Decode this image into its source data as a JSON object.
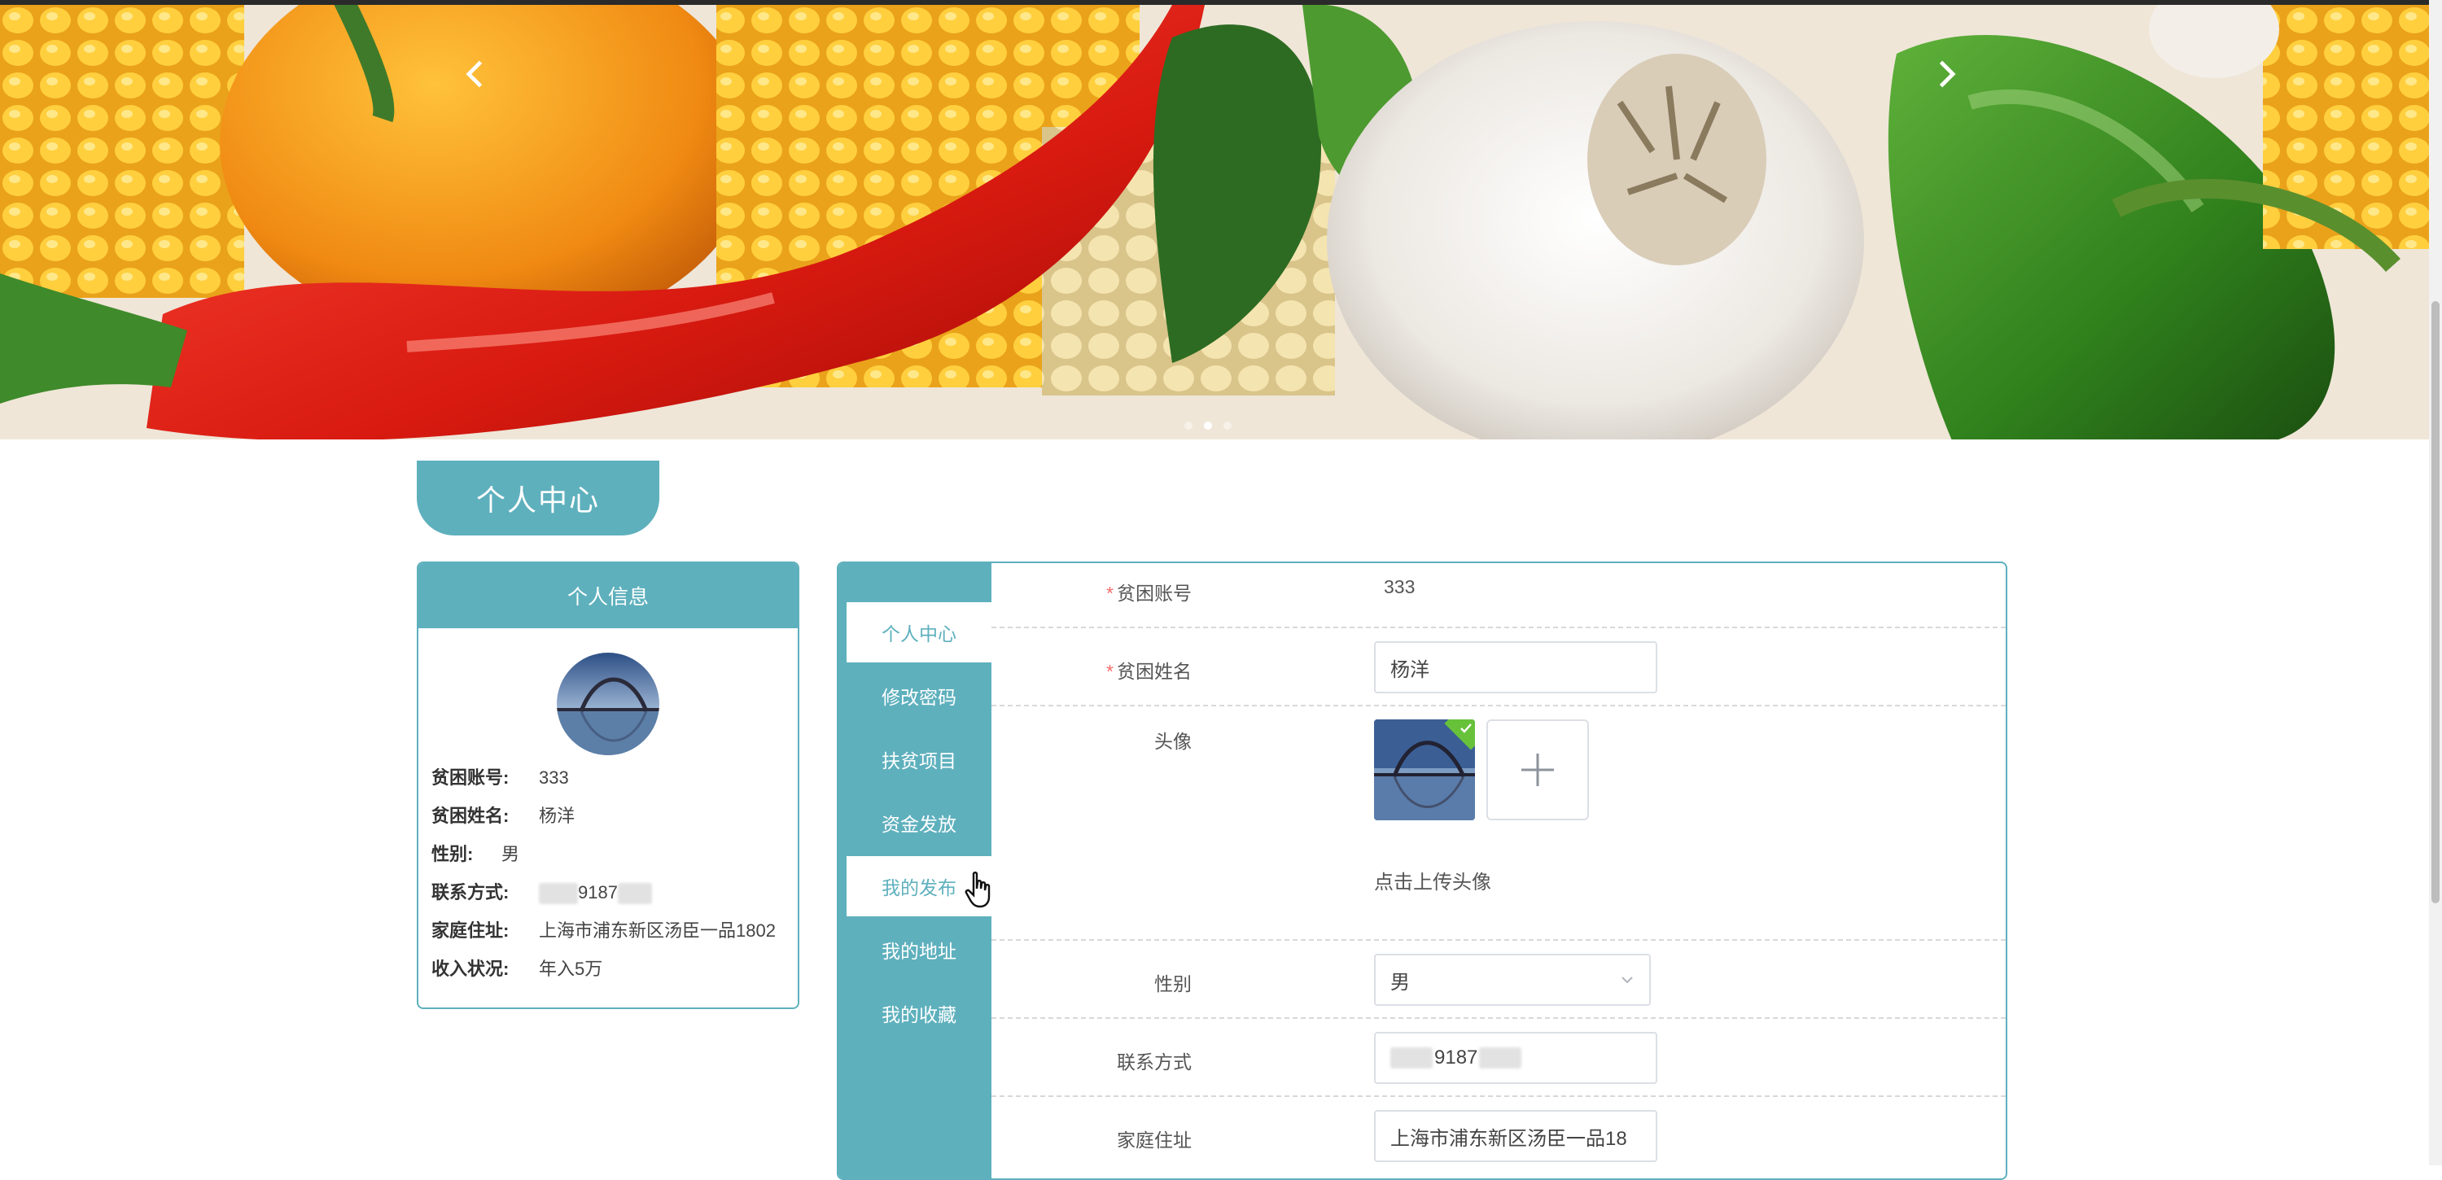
{
  "banner": {
    "prev_icon": "chevron-left-icon",
    "next_icon": "chevron-right-icon",
    "slides": 3,
    "active_slide": 2
  },
  "page_title": "个人中心",
  "info_card": {
    "header": "个人信息",
    "rows": [
      {
        "label": "贫困账号:",
        "value": "333"
      },
      {
        "label": "贫困姓名:",
        "value": "杨洋"
      },
      {
        "label": "性别:",
        "value": "男"
      },
      {
        "label": "联系方式:",
        "value": "9187"
      },
      {
        "label": "家庭住址:",
        "value": "上海市浦东新区汤臣一品1802"
      },
      {
        "label": "收入状况:",
        "value": "年入5万"
      }
    ]
  },
  "side_menu": {
    "items": [
      "个人中心",
      "修改密码",
      "扶贫项目",
      "资金发放",
      "我的发布",
      "我的地址",
      "我的收藏"
    ],
    "active": "个人中心"
  },
  "form": {
    "account_label": "贫困账号",
    "account_value": "333",
    "name_label": "贫困姓名",
    "name_value": "杨洋",
    "avatar_label": "头像",
    "avatar_hint": "点击上传头像",
    "gender_label": "性别",
    "gender_value": "男",
    "phone_label": "联系方式",
    "phone_value": "9187",
    "address_label": "家庭住址",
    "address_value": "上海市浦东新区汤臣一品18"
  },
  "colors": {
    "accent": "#5eb0bd",
    "required": "#f56c6c",
    "success": "#67c23a"
  }
}
